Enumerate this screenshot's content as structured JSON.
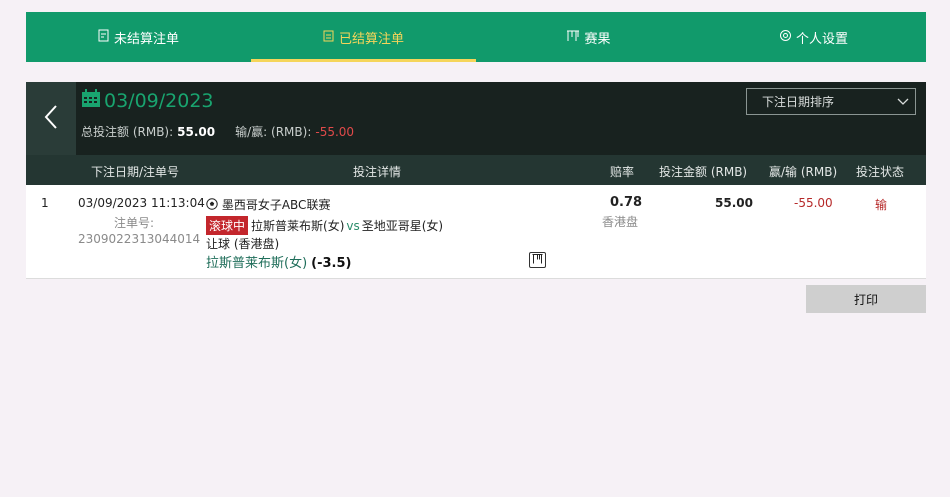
{
  "tabs": [
    {
      "label": "未结算注单",
      "icon": "unsettled-bets-icon"
    },
    {
      "label": "已结算注单",
      "icon": "settled-bets-icon",
      "active": true
    },
    {
      "label": "赛果",
      "icon": "results-icon"
    },
    {
      "label": "个人设置",
      "icon": "settings-gear-icon"
    }
  ],
  "header": {
    "date": "03/09/2023",
    "total_stake_label": "总投注额 (RMB):",
    "total_stake_value": "55.00",
    "win_loss_label": "输/赢: (RMB):",
    "win_loss_value": "-55.00",
    "sort_label": "下注日期排序"
  },
  "columns": {
    "date_id": "下注日期/注单号",
    "details": "投注详情",
    "odds": "赔率",
    "stake": "投注金额 (RMB)",
    "win_loss": "赢/输 (RMB)",
    "status": "投注状态"
  },
  "bets": [
    {
      "index": "1",
      "datetime": "03/09/2023 11:13:04",
      "ticket_label": "注单号:",
      "ticket_no": "2309022313044014",
      "league": "墨西哥女子ABC联赛",
      "live_badge": "滚球中",
      "home": "拉斯普莱布斯(女)",
      "vs": "vs",
      "away": "圣地亚哥星(女)",
      "market": "让球 (香港盘)",
      "selection": "拉斯普莱布斯(女)",
      "handicap": "(-3.5)",
      "odds": "0.78",
      "odds_type": "香港盘",
      "stake": "55.00",
      "win_loss": "-55.00",
      "status": "输"
    }
  ],
  "print_label": "打印",
  "colors": {
    "brand_green": "#119a6b",
    "active_tab": "#f5d55a",
    "loss_red": "#b62929",
    "live_red": "#c3262c"
  }
}
